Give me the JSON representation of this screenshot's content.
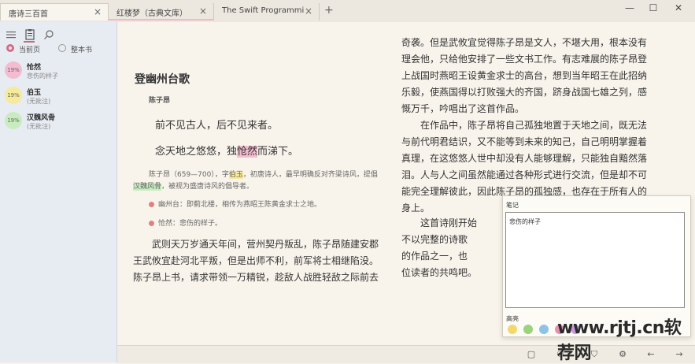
{
  "tabs": [
    {
      "label": "唐诗三百首",
      "close": "×"
    },
    {
      "label": "红楼梦（古典文库）",
      "close": "×"
    },
    {
      "label": "The Swift Programming Language (5",
      "close": "×"
    }
  ],
  "new_tab": "+",
  "window_controls": {
    "minimize": "—",
    "maximize": "☐",
    "close": "✕"
  },
  "sidebar": {
    "scope": {
      "current_page": "当前页",
      "whole_book": "整本书"
    },
    "notes": [
      {
        "percent": "19%",
        "title": "怆然",
        "subtitle": "悲伤的样子",
        "color": "#f3bcd0"
      },
      {
        "percent": "19%",
        "title": "伯玉",
        "subtitle": "(无批注)",
        "color": "#f6ea9b"
      },
      {
        "percent": "19%",
        "title": "汉魏风骨",
        "subtitle": "(无批注)",
        "color": "#c9ecbf"
      }
    ]
  },
  "poem": {
    "title": "登幽州台歌",
    "author": "陈子昂",
    "line1": "前不见古人，后不见来者。",
    "line2_a": "念天地之悠悠，独",
    "line2_hl": "怆然",
    "line2_b": "而涕下。",
    "bio_a": "陈子昂（659—700），字",
    "bio_hl1": "伯玉",
    "bio_b": "，初唐诗人，最早明确反对齐梁诗风，提倡",
    "bio_hl2": "汉魏风骨",
    "bio_c": "，被视为盛唐诗风的倡导者。",
    "note1": "幽州台：即蓟北楼，相传为燕昭王陈黄金求士之地。",
    "note2": "怆然：悲伤的样子。",
    "left_para": [
      "武则天万岁通天年间，营州契丹叛乱，陈子昂随建安郡",
      "王武攸宜赴河北平叛，但是出师不利，前军将士相继陷没。",
      "陈子昂上书，请求带领一万精锐，趁敌人战胜轻敌之际前去"
    ],
    "right_para1": [
      "奇袭。但是武攸宜觉得陈子昂是文人，不堪大用，根本没有",
      "理会他，只给他安排了一些文书工作。有志难展的陈子昂登",
      "上战国时燕昭王设黄金求士的高台，想到当年昭王在此招纳",
      "乐毅，使燕国得以打败强大的齐国，跻身战国七雄之列，感",
      "慨万千，吟唱出了这首作品。"
    ],
    "right_para2": [
      "在作品中，陈子昂将自己孤独地置于天地之间，既无法",
      "与前代明君结识，又不能等到未来的知己，自己明明掌握着",
      "真理，在这悠悠人世中却没有人能够理解，只能独自黯然落",
      "泪。人与人之间虽然能通过各种形式进行交流，但是却不可",
      "能完全理解彼此，因此陈子昂的孤独感，也存在于所有人的",
      "身上。"
    ],
    "right_para3": [
      "这首诗刚开始",
      "不以完整的诗歌",
      "的作品之一，也",
      "位读者的共鸣吧。"
    ]
  },
  "note_panel": {
    "header": "笔记",
    "text": "悲伤的样子",
    "highlight_header": "高亮",
    "swatches": [
      "#f5d76e",
      "#9ad37a",
      "#8fc2e8",
      "#e88fb0",
      "#c59be0"
    ]
  },
  "bottom_toolbar": {
    "icons": [
      "book-icon",
      "people-icon",
      "bookmark-icon",
      "gear-icon",
      "back-arrow-icon",
      "forward-arrow-icon"
    ],
    "glyphs": [
      "▢",
      "⚇",
      "⛉",
      "⚙",
      "←",
      "→"
    ]
  },
  "watermark": "www.rjtj.cn软荐网"
}
